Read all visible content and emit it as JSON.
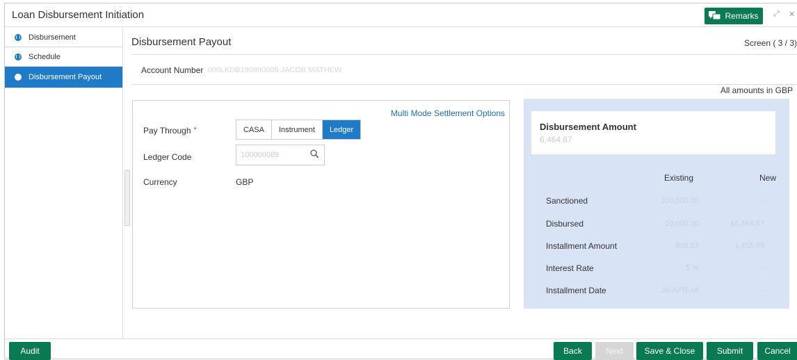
{
  "window": {
    "title": "Loan Disbursement Initiation",
    "remarks_label": "Remarks"
  },
  "sidebar": {
    "items": [
      {
        "label": "Disbursement",
        "state": "done"
      },
      {
        "label": "Schedule",
        "state": "done"
      },
      {
        "label": "Disbursement Payout",
        "state": "active"
      }
    ]
  },
  "main": {
    "title": "Disbursement Payout",
    "screen_indicator": "Screen ( 3 / 3)",
    "account_label": "Account Number",
    "account_value": "000LKDB190890005 JACOB MATHEW",
    "amounts_note": "All amounts in GBP"
  },
  "form": {
    "multi_mode_link": "Multi Mode Settlement Options",
    "pay_through_label": "Pay Through",
    "required_mark": "*",
    "pay_options": [
      "CASA",
      "Instrument",
      "Ledger"
    ],
    "pay_selected": "Ledger",
    "ledger_code_label": "Ledger Code",
    "ledger_code_value": "100000089",
    "currency_label": "Currency",
    "currency_value": "GBP"
  },
  "disbursement": {
    "title": "Disbursement Amount",
    "amount": "6,464.67",
    "columns": [
      "Existing",
      "New"
    ],
    "rows": [
      {
        "label": "Sanctioned",
        "existing": "100,000.00",
        "new": "-"
      },
      {
        "label": "Disbursed",
        "existing": "10,000.00",
        "new": "16,464.67"
      },
      {
        "label": "Installment Amount",
        "existing": "908.57",
        "new": "1,455.55"
      },
      {
        "label": "Interest Rate",
        "existing": "5 %",
        "new": "-"
      },
      {
        "label": "Installment Date",
        "existing": "30-APR-18",
        "new": "-"
      }
    ]
  },
  "footer": {
    "audit": "Audit",
    "back": "Back",
    "next": "Next",
    "save_close": "Save & Close",
    "submit": "Submit",
    "cancel": "Cancel"
  },
  "colors": {
    "primary_green": "#0a7a52",
    "active_blue": "#1f7bc8",
    "panel_blue": "#d8e4f5"
  }
}
